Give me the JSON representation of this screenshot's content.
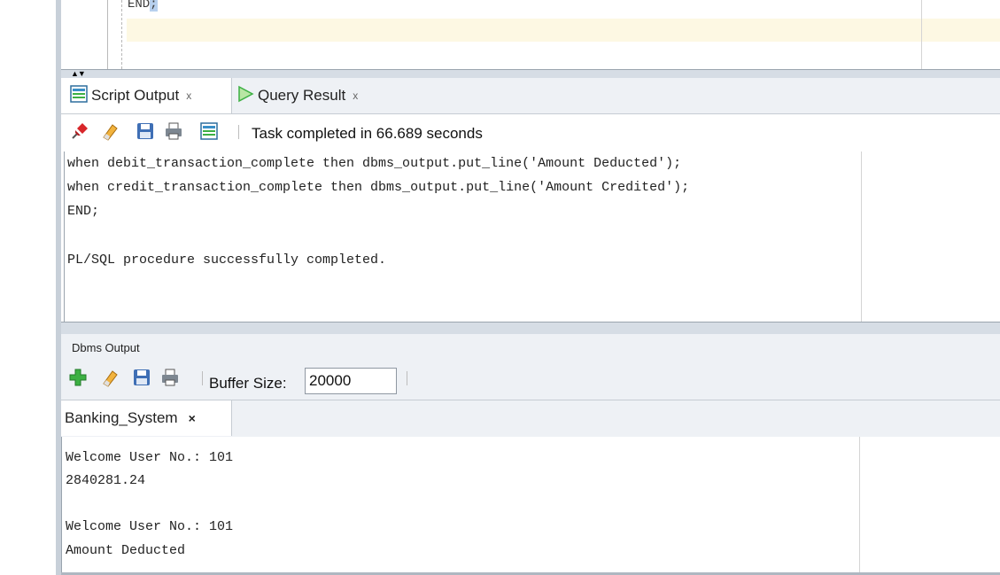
{
  "editor": {
    "visible_line": "END;",
    "line_keyword": "END",
    "line_terminator": ";"
  },
  "script_output_panel": {
    "tabs": [
      {
        "label": "Script Output",
        "close": "x"
      },
      {
        "label": "Query Result",
        "close": "x"
      }
    ],
    "toolbar_icons": [
      "pin-icon",
      "eraser-icon",
      "save-icon",
      "print-icon",
      "script-icon"
    ],
    "status": "Task completed in 66.689 seconds",
    "lines": [
      "when debit_transaction_complete then dbms_output.put_line('Amount Deducted');",
      "when credit_transaction_complete then dbms_output.put_line('Amount Credited');",
      "END;",
      "",
      "PL/SQL procedure successfully completed."
    ]
  },
  "dbms_output_panel": {
    "title": "Dbms Output",
    "toolbar_icons": [
      "add-icon",
      "eraser-icon",
      "save-icon",
      "print-icon"
    ],
    "buffer_label": "Buffer Size:",
    "buffer_value": "20000",
    "tab": {
      "label": "Banking_System",
      "close": "×"
    },
    "lines": [
      "Welcome User No.: 101",
      "2840281.24",
      "",
      "Welcome User No.: 101",
      "Amount Deducted"
    ]
  },
  "colors": {
    "panel_bg": "#eef1f5",
    "current_line": "#fdf8e3",
    "selection": "#b7d0ee",
    "play_green": "#3cb043",
    "pin_red": "#d8262a"
  }
}
